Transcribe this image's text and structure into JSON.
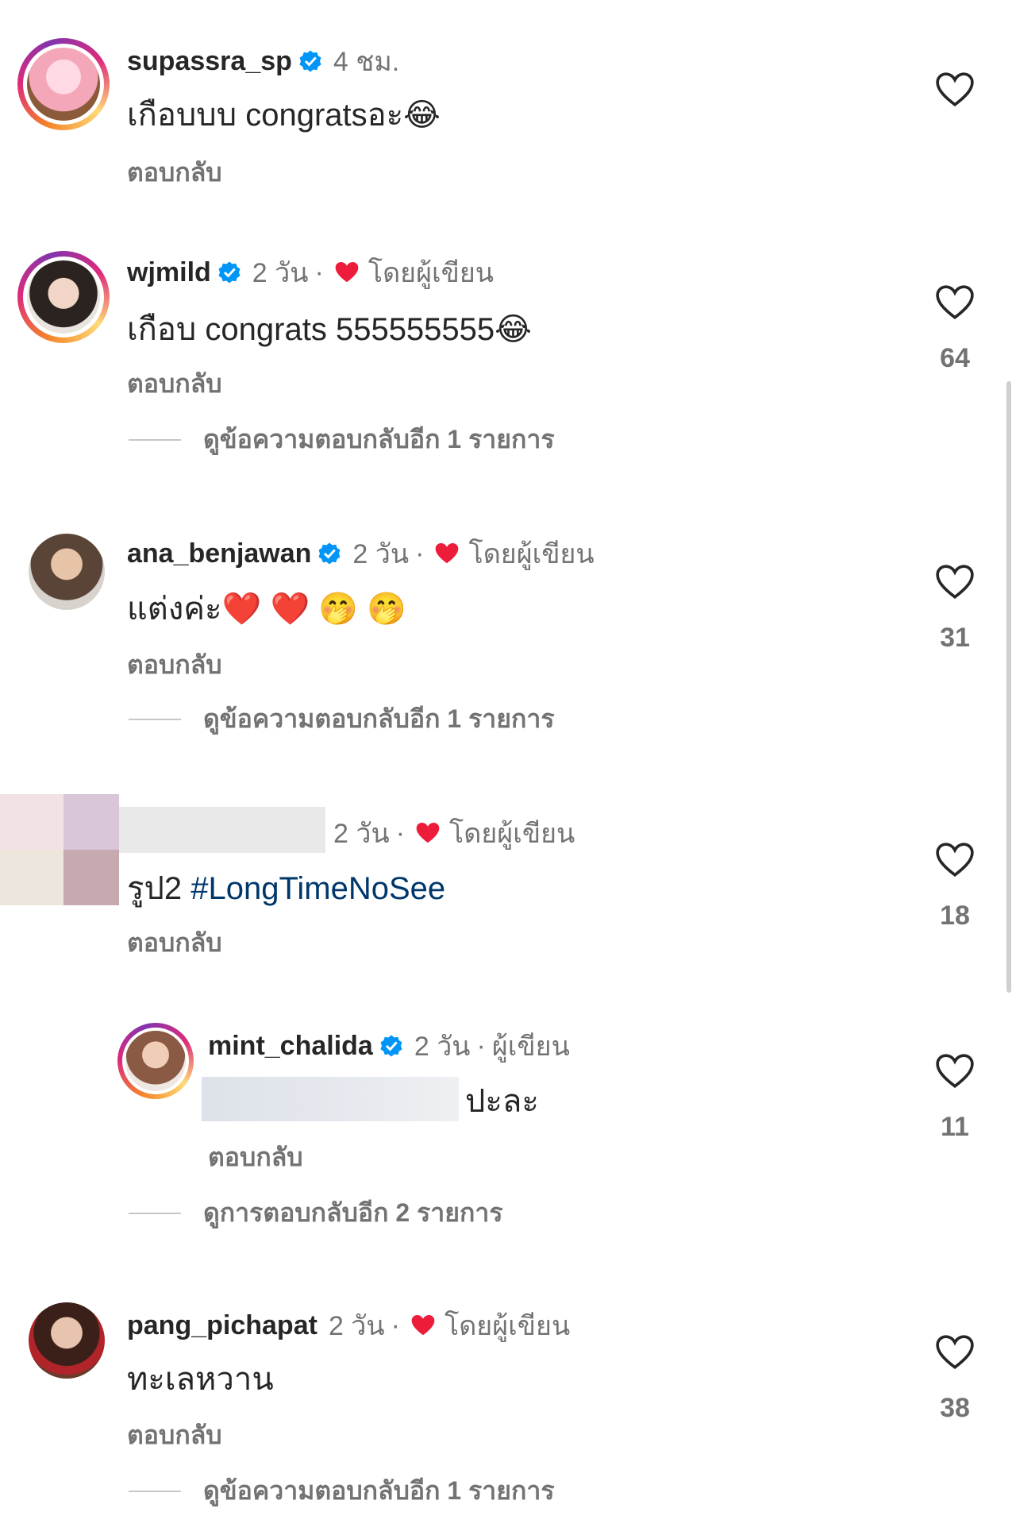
{
  "ui": {
    "reply_label": "ตอบกลับ",
    "by_author": "โดยผู้เขียน",
    "author": "ผู้เขียน",
    "dot": "·",
    "verified_icon": "verified-badge-icon",
    "like_icon": "heart-outline-icon",
    "colors": {
      "verified": "#0095f6",
      "heart": "#ed1c3a",
      "hashtag": "#00376b",
      "meta": "#737373"
    }
  },
  "comments": [
    {
      "username": "supassra_sp",
      "verified": true,
      "time": "4 ชม.",
      "text": "เกือบบบ congratsอะ",
      "emoji": "😂",
      "likes": null,
      "more_replies": null
    },
    {
      "username": "wjmild",
      "verified": true,
      "time": "2 วัน",
      "liked_by_author": true,
      "text": "เกือบ congrats 555555555",
      "emoji": "😂",
      "likes": "64",
      "more_replies": "ดูข้อความตอบกลับอีก 1 รายการ"
    },
    {
      "username": "ana_benjawan",
      "verified": true,
      "time": "2 วัน",
      "liked_by_author": true,
      "text": "แต่งค่ะ",
      "emoji": "❤️ ❤️ 🤭 🤭",
      "likes": "31",
      "more_replies": "ดูข้อความตอบกลับอีก 1 รายการ"
    },
    {
      "username": "",
      "verified": false,
      "time": "2 วัน",
      "liked_by_author": true,
      "text_prefix": "รูป2 ",
      "hashtag": "#LongTimeNoSee",
      "likes": "18"
    },
    {
      "username": "mint_chalida",
      "verified": true,
      "time": "2 วัน",
      "author_tag": "ผู้เขียน",
      "text": "ปะละ",
      "likes": "11",
      "more_replies": "ดูการตอบกลับอีก 2 รายการ"
    },
    {
      "username": "pang_pichapat",
      "verified": false,
      "time": "2 วัน",
      "liked_by_author": true,
      "text": "ทะเลหวาน",
      "likes": "38",
      "more_replies": "ดูข้อความตอบกลับอีก 1 รายการ"
    }
  ]
}
